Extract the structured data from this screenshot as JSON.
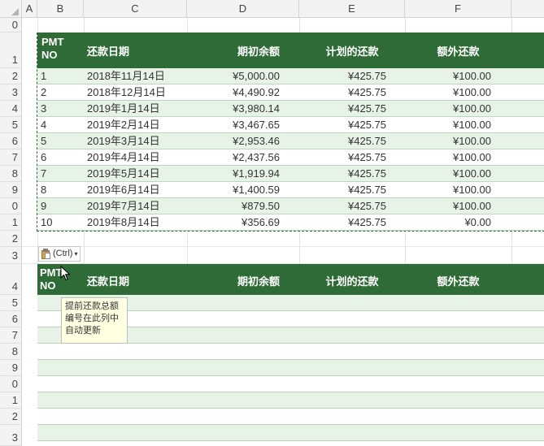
{
  "columns": [
    "A",
    "B",
    "C",
    "D",
    "E",
    "F"
  ],
  "row_numbers": [
    "0",
    "1",
    "2",
    "3",
    "4",
    "5",
    "6",
    "7",
    "8",
    "9",
    "0",
    "1",
    "2",
    "3",
    "4",
    "5",
    "6",
    "7",
    "8",
    "9",
    "0",
    "1",
    "2",
    "3"
  ],
  "table1": {
    "headers": {
      "pmt_line1": "PMT",
      "pmt_line2": "NO",
      "date": "还款日期",
      "opening_balance": "期初余额",
      "scheduled_payment": "计划的还款",
      "extra_payment": "额外还款"
    },
    "rows": [
      {
        "no": "1",
        "date": "2018年11月14日",
        "balance": "¥5,000.00",
        "scheduled": "¥425.75",
        "extra": "¥100.00"
      },
      {
        "no": "2",
        "date": "2018年12月14日",
        "balance": "¥4,490.92",
        "scheduled": "¥425.75",
        "extra": "¥100.00"
      },
      {
        "no": "3",
        "date": "2019年1月14日",
        "balance": "¥3,980.14",
        "scheduled": "¥425.75",
        "extra": "¥100.00"
      },
      {
        "no": "4",
        "date": "2019年2月14日",
        "balance": "¥3,467.65",
        "scheduled": "¥425.75",
        "extra": "¥100.00"
      },
      {
        "no": "5",
        "date": "2019年3月14日",
        "balance": "¥2,953.46",
        "scheduled": "¥425.75",
        "extra": "¥100.00"
      },
      {
        "no": "6",
        "date": "2019年4月14日",
        "balance": "¥2,437.56",
        "scheduled": "¥425.75",
        "extra": "¥100.00"
      },
      {
        "no": "7",
        "date": "2019年5月14日",
        "balance": "¥1,919.94",
        "scheduled": "¥425.75",
        "extra": "¥100.00"
      },
      {
        "no": "8",
        "date": "2019年6月14日",
        "balance": "¥1,400.59",
        "scheduled": "¥425.75",
        "extra": "¥100.00"
      },
      {
        "no": "9",
        "date": "2019年7月14日",
        "balance": "¥879.50",
        "scheduled": "¥425.75",
        "extra": "¥100.00"
      },
      {
        "no": "10",
        "date": "2019年8月14日",
        "balance": "¥356.69",
        "scheduled": "¥425.75",
        "extra": "¥0.00"
      }
    ]
  },
  "table2": {
    "headers": {
      "pmt_line1": "PMT",
      "pmt_line2": "NO",
      "date": "还款日期",
      "opening_balance": "期初余额",
      "scheduled_payment": "计划的还款",
      "extra_payment": "额外还款"
    }
  },
  "paste_options": {
    "label": "(Ctrl)",
    "arrow": "▾"
  },
  "comment": {
    "lines": [
      "提前还款总额",
      "编号在此列中",
      "自动更新"
    ]
  },
  "colors": {
    "header_green": "#2f6b36",
    "band_light": "#e8f3e7",
    "comment_bg": "#ffffe1"
  },
  "icons": {
    "paste": "clipboard-paste-icon",
    "cursor": "mouse-pointer-icon"
  }
}
